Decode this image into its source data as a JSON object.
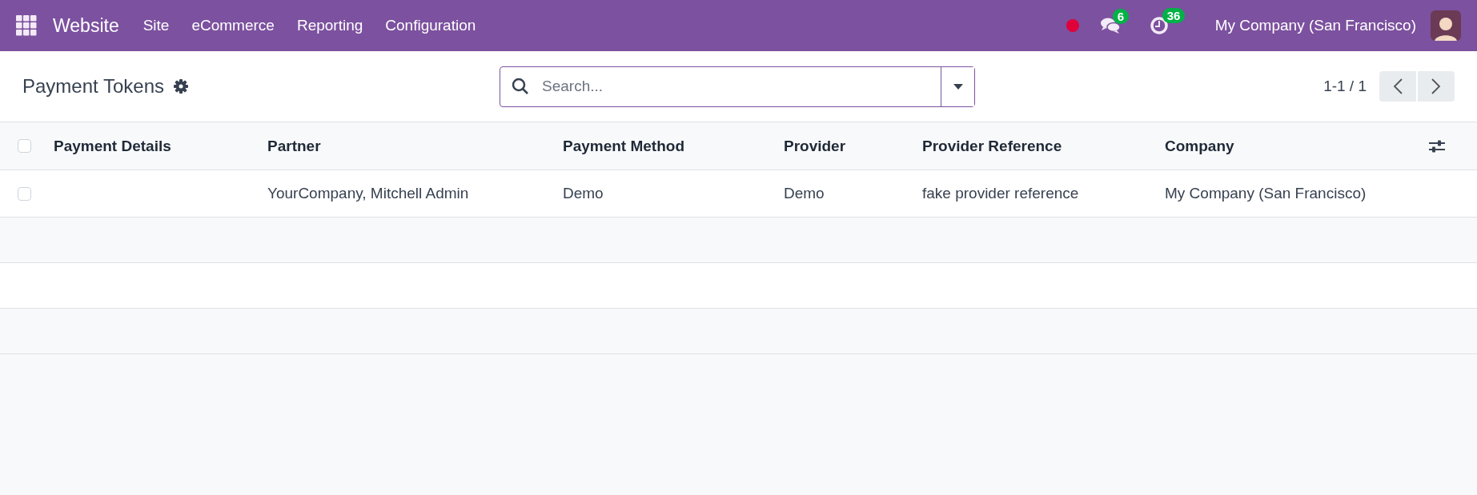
{
  "navbar": {
    "app_name": "Website",
    "menu": [
      "Site",
      "eCommerce",
      "Reporting",
      "Configuration"
    ],
    "messages_badge": "6",
    "activities_badge": "36",
    "company": "My Company (San Francisco)"
  },
  "control_panel": {
    "title": "Payment Tokens",
    "search": {
      "placeholder": "Search..."
    },
    "pager": "1-1 / 1"
  },
  "table": {
    "select_all_checked": false,
    "columns": [
      "Payment Details",
      "Partner",
      "Payment Method",
      "Provider",
      "Provider Reference",
      "Company"
    ],
    "rows": [
      {
        "checked": false,
        "cells": [
          "",
          "YourCompany, Mitchell Admin",
          "Demo",
          "Demo",
          "fake provider reference",
          "My Company (San Francisco)"
        ]
      }
    ]
  }
}
